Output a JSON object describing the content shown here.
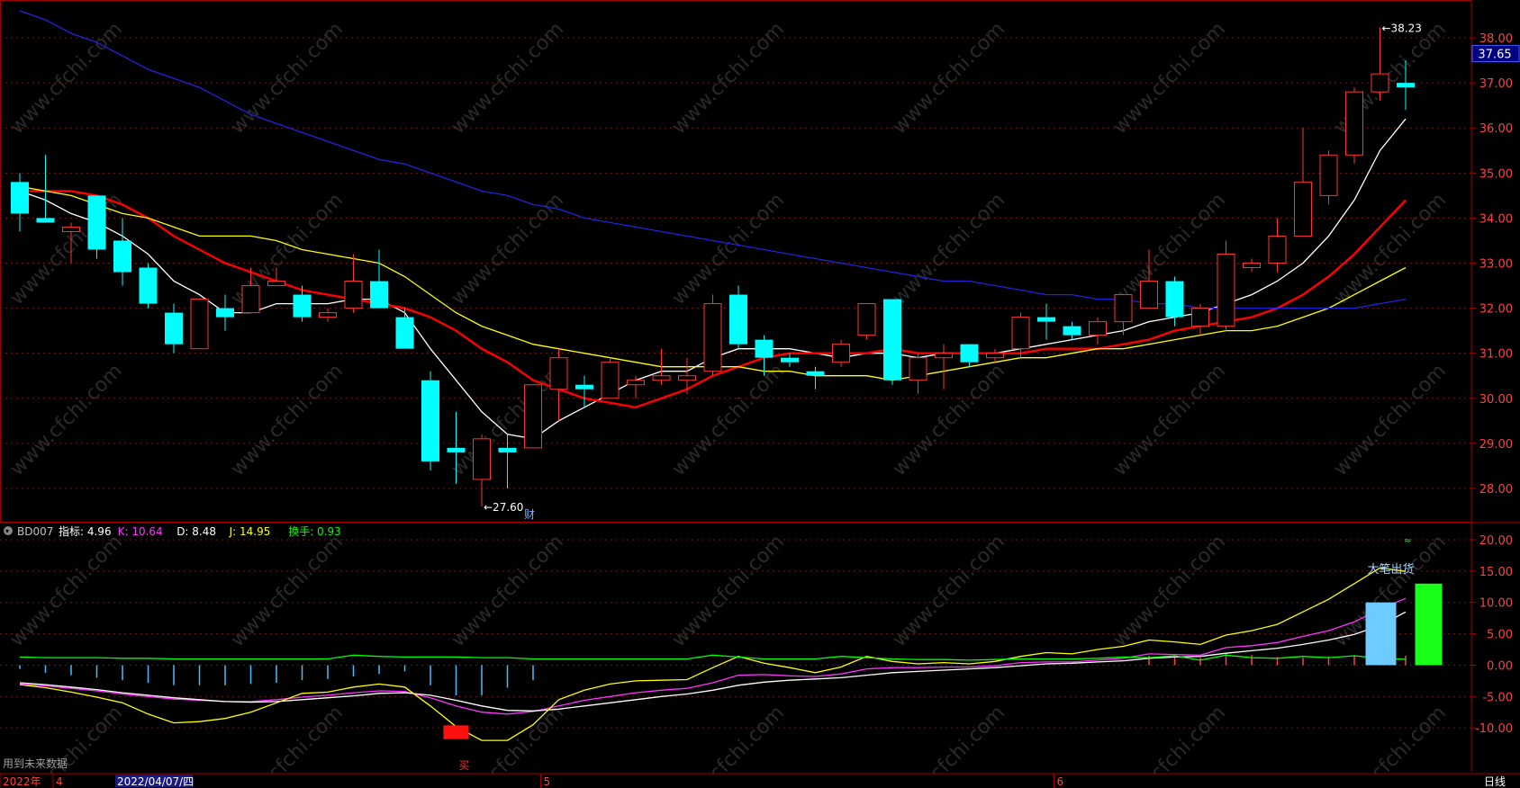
{
  "chart_data": [
    {
      "type": "candlestick",
      "title": "",
      "ylim": [
        27.3,
        38.6
      ],
      "y_ticks": [
        28,
        29,
        30,
        31,
        32,
        33,
        34,
        35,
        36,
        37,
        38
      ],
      "y_tick_labels": [
        "28.00",
        "29.00",
        "30.00",
        "31.00",
        "32.00",
        "33.00",
        "34.00",
        "35.00",
        "36.00",
        "37.00",
        "38.00"
      ],
      "current_price": 37.65,
      "current_price_label": "37.65",
      "max_label": "38.23",
      "min_label": "27.60",
      "event_marker": "财",
      "candles": [
        {
          "o": 34.8,
          "h": 35.0,
          "l": 33.7,
          "c": 34.1
        },
        {
          "o": 34.0,
          "h": 35.4,
          "l": 33.9,
          "c": 33.9
        },
        {
          "o": 33.7,
          "h": 33.9,
          "l": 33.0,
          "c": 33.8
        },
        {
          "o": 34.5,
          "h": 34.5,
          "l": 33.1,
          "c": 33.3
        },
        {
          "o": 33.5,
          "h": 34.0,
          "l": 32.5,
          "c": 32.8
        },
        {
          "o": 32.9,
          "h": 33.0,
          "l": 32.0,
          "c": 32.1
        },
        {
          "o": 31.9,
          "h": 32.1,
          "l": 31.0,
          "c": 31.2
        },
        {
          "o": 31.1,
          "h": 32.2,
          "l": 31.1,
          "c": 32.2
        },
        {
          "o": 32.0,
          "h": 32.3,
          "l": 31.5,
          "c": 31.8
        },
        {
          "o": 31.9,
          "h": 32.9,
          "l": 31.9,
          "c": 32.5
        },
        {
          "o": 32.5,
          "h": 32.9,
          "l": 32.5,
          "c": 32.6
        },
        {
          "o": 32.3,
          "h": 32.5,
          "l": 31.7,
          "c": 31.8
        },
        {
          "o": 31.8,
          "h": 32.0,
          "l": 31.7,
          "c": 31.9
        },
        {
          "o": 32.0,
          "h": 33.2,
          "l": 31.9,
          "c": 32.6
        },
        {
          "o": 32.6,
          "h": 33.3,
          "l": 32.0,
          "c": 32.0
        },
        {
          "o": 31.8,
          "h": 32.0,
          "l": 31.3,
          "c": 31.1
        },
        {
          "o": 30.4,
          "h": 30.6,
          "l": 28.4,
          "c": 28.6
        },
        {
          "o": 28.9,
          "h": 29.7,
          "l": 28.1,
          "c": 28.8
        },
        {
          "o": 28.2,
          "h": 29.2,
          "l": 27.6,
          "c": 29.1
        },
        {
          "o": 28.9,
          "h": 29.2,
          "l": 28.0,
          "c": 28.8
        },
        {
          "o": 28.9,
          "h": 30.3,
          "l": 28.9,
          "c": 30.3
        },
        {
          "o": 30.2,
          "h": 31.1,
          "l": 29.5,
          "c": 30.9
        },
        {
          "o": 30.3,
          "h": 30.5,
          "l": 29.8,
          "c": 30.2
        },
        {
          "o": 30.0,
          "h": 30.9,
          "l": 30.0,
          "c": 30.8
        },
        {
          "o": 30.3,
          "h": 30.5,
          "l": 30.0,
          "c": 30.4
        },
        {
          "o": 30.4,
          "h": 31.1,
          "l": 30.3,
          "c": 30.5
        },
        {
          "o": 30.4,
          "h": 30.9,
          "l": 30.1,
          "c": 30.5
        },
        {
          "o": 30.6,
          "h": 32.3,
          "l": 30.5,
          "c": 32.1
        },
        {
          "o": 32.3,
          "h": 32.5,
          "l": 31.1,
          "c": 31.2
        },
        {
          "o": 31.3,
          "h": 31.4,
          "l": 30.5,
          "c": 30.9
        },
        {
          "o": 30.9,
          "h": 31.0,
          "l": 30.7,
          "c": 30.8
        },
        {
          "o": 30.6,
          "h": 30.7,
          "l": 30.2,
          "c": 30.5
        },
        {
          "o": 30.8,
          "h": 31.3,
          "l": 30.7,
          "c": 31.2
        },
        {
          "o": 31.4,
          "h": 32.1,
          "l": 31.3,
          "c": 32.1
        },
        {
          "o": 32.2,
          "h": 32.2,
          "l": 30.3,
          "c": 30.4
        },
        {
          "o": 30.4,
          "h": 31.0,
          "l": 30.1,
          "c": 30.9
        },
        {
          "o": 30.9,
          "h": 31.2,
          "l": 30.2,
          "c": 31.0
        },
        {
          "o": 31.2,
          "h": 31.2,
          "l": 30.7,
          "c": 30.8
        },
        {
          "o": 30.9,
          "h": 31.1,
          "l": 30.8,
          "c": 31.0
        },
        {
          "o": 31.1,
          "h": 31.9,
          "l": 30.9,
          "c": 31.8
        },
        {
          "o": 31.8,
          "h": 32.1,
          "l": 31.3,
          "c": 31.7
        },
        {
          "o": 31.6,
          "h": 31.7,
          "l": 31.3,
          "c": 31.4
        },
        {
          "o": 31.4,
          "h": 31.8,
          "l": 31.2,
          "c": 31.7
        },
        {
          "o": 31.7,
          "h": 32.3,
          "l": 31.4,
          "c": 32.3
        },
        {
          "o": 32.0,
          "h": 33.3,
          "l": 32.0,
          "c": 32.6
        },
        {
          "o": 32.6,
          "h": 32.7,
          "l": 31.6,
          "c": 31.8
        },
        {
          "o": 31.6,
          "h": 32.1,
          "l": 31.4,
          "c": 32.0
        },
        {
          "o": 31.6,
          "h": 33.5,
          "l": 31.5,
          "c": 33.2
        },
        {
          "o": 32.9,
          "h": 33.1,
          "l": 32.8,
          "c": 33.0
        },
        {
          "o": 33.0,
          "h": 34.0,
          "l": 32.8,
          "c": 33.6
        },
        {
          "o": 33.6,
          "h": 36.0,
          "l": 33.6,
          "c": 34.8
        },
        {
          "o": 34.5,
          "h": 35.5,
          "l": 34.3,
          "c": 35.4
        },
        {
          "o": 35.4,
          "h": 36.9,
          "l": 35.2,
          "c": 36.8
        },
        {
          "o": 36.8,
          "h": 38.23,
          "l": 36.6,
          "c": 37.2
        },
        {
          "o": 37.0,
          "h": 37.5,
          "l": 36.4,
          "c": 36.9
        }
      ],
      "ma": [
        {
          "name": "MA5",
          "color": "#ffffff",
          "values": [
            34.6,
            34.4,
            34.1,
            33.9,
            33.6,
            33.2,
            32.6,
            32.3,
            31.9,
            31.9,
            32.1,
            32.1,
            32.1,
            32.2,
            32.2,
            31.9,
            31.1,
            30.4,
            29.7,
            29.2,
            29.1,
            29.5,
            29.8,
            30.1,
            30.4,
            30.6,
            30.6,
            30.9,
            31.1,
            31.1,
            31.1,
            31.0,
            30.9,
            31.0,
            31.0,
            30.9,
            31.0,
            31.0,
            31.0,
            31.1,
            31.2,
            31.3,
            31.4,
            31.5,
            31.7,
            31.8,
            31.9,
            32.1,
            32.3,
            32.6,
            33.0,
            33.6,
            34.4,
            35.5,
            36.2
          ]
        },
        {
          "name": "MA10",
          "color": "#ff0000",
          "values": [
            34.6,
            34.6,
            34.6,
            34.5,
            34.3,
            34.0,
            33.6,
            33.3,
            33.0,
            32.8,
            32.6,
            32.4,
            32.3,
            32.2,
            32.1,
            32.0,
            31.8,
            31.5,
            31.1,
            30.8,
            30.4,
            30.2,
            30.0,
            29.9,
            29.8,
            30.0,
            30.2,
            30.5,
            30.7,
            30.9,
            31.0,
            31.0,
            31.0,
            31.0,
            31.1,
            31.0,
            31.0,
            31.0,
            31.0,
            31.0,
            31.1,
            31.1,
            31.1,
            31.2,
            31.3,
            31.5,
            31.6,
            31.7,
            31.8,
            32.0,
            32.3,
            32.7,
            33.2,
            33.8,
            34.4
          ]
        },
        {
          "name": "MA20",
          "color": "#ffff00",
          "values": [
            34.7,
            34.6,
            34.5,
            34.3,
            34.1,
            34.0,
            33.8,
            33.6,
            33.6,
            33.6,
            33.5,
            33.3,
            33.2,
            33.1,
            33.0,
            32.7,
            32.3,
            31.9,
            31.6,
            31.4,
            31.2,
            31.1,
            31.0,
            30.9,
            30.8,
            30.7,
            30.7,
            30.7,
            30.7,
            30.6,
            30.6,
            30.5,
            30.5,
            30.5,
            30.4,
            30.5,
            30.6,
            30.7,
            30.8,
            30.9,
            30.9,
            31.0,
            31.1,
            31.1,
            31.2,
            31.3,
            31.4,
            31.5,
            31.5,
            31.6,
            31.8,
            32.0,
            32.3,
            32.6,
            32.9
          ]
        },
        {
          "name": "MA60",
          "color": "#2222dd",
          "values": [
            38.6,
            38.4,
            38.1,
            37.9,
            37.6,
            37.3,
            37.1,
            36.9,
            36.6,
            36.3,
            36.1,
            35.9,
            35.7,
            35.5,
            35.3,
            35.2,
            35.0,
            34.8,
            34.6,
            34.5,
            34.3,
            34.2,
            34.0,
            33.9,
            33.8,
            33.7,
            33.6,
            33.5,
            33.4,
            33.3,
            33.2,
            33.1,
            33.0,
            32.9,
            32.8,
            32.7,
            32.6,
            32.6,
            32.5,
            32.4,
            32.3,
            32.3,
            32.2,
            32.2,
            32.1,
            32.1,
            32.0,
            32.0,
            32.0,
            32.0,
            32.0,
            32.0,
            32.0,
            32.1,
            32.2
          ]
        }
      ]
    },
    {
      "type": "line",
      "title": "BD007",
      "ylim": [
        -17,
        22
      ],
      "y_ticks": [
        20,
        15,
        10,
        5,
        0,
        -5,
        -10
      ],
      "y_tick_labels": [
        "20.00",
        "15.00",
        "10.00",
        "5.00",
        "0.00",
        "-5.00",
        "-10.00"
      ],
      "legend": [
        {
          "label": "BD007",
          "color": "#c0c0c0"
        },
        {
          "label": "指标: 4.96",
          "color": "#ffffff"
        },
        {
          "label": "K: 10.64",
          "color": "#ff33ff"
        },
        {
          "label": "D: 8.48",
          "color": "#ffffff"
        },
        {
          "label": "J: 14.95",
          "color": "#ffff00"
        },
        {
          "label": "换手: 0.93",
          "color": "#00ff00"
        }
      ],
      "series": [
        {
          "name": "K",
          "color": "#ff33ff",
          "values": [
            -3,
            -3.3,
            -3.7,
            -4.1,
            -4.6,
            -5,
            -5.4,
            -5.6,
            -5.8,
            -5.8,
            -5.5,
            -5.1,
            -4.8,
            -4.4,
            -4.1,
            -4.2,
            -5.2,
            -6.5,
            -7.5,
            -7.8,
            -7.4,
            -6.5,
            -5.6,
            -5,
            -4.4,
            -4,
            -3.7,
            -2.8,
            -1.6,
            -1.5,
            -1.7,
            -1.8,
            -1.4,
            -0.6,
            -0.4,
            -0.4,
            -0.3,
            -0.3,
            -0.1,
            0.4,
            0.5,
            0.5,
            0.8,
            1.1,
            1.8,
            1.7,
            1.6,
            2.8,
            3.1,
            3.6,
            4.6,
            5.5,
            6.9,
            8.9,
            10.64
          ]
        },
        {
          "name": "D",
          "color": "#ffffff",
          "values": [
            -2.8,
            -3.1,
            -3.5,
            -3.9,
            -4.4,
            -4.8,
            -5.2,
            -5.5,
            -5.8,
            -5.9,
            -5.8,
            -5.5,
            -5.2,
            -4.9,
            -4.5,
            -4.4,
            -4.8,
            -5.6,
            -6.5,
            -7.2,
            -7.3,
            -7,
            -6.5,
            -6,
            -5.5,
            -5,
            -4.6,
            -4,
            -3.2,
            -2.7,
            -2.4,
            -2.2,
            -2,
            -1.6,
            -1.2,
            -1,
            -0.8,
            -0.6,
            -0.4,
            -0.1,
            0.2,
            0.3,
            0.5,
            0.7,
            1.1,
            1.3,
            1.4,
            1.9,
            2.3,
            2.7,
            3.3,
            4,
            4.9,
            6.3,
            8.48
          ]
        },
        {
          "name": "J",
          "color": "#ffff00",
          "values": [
            -3.1,
            -3.6,
            -4.3,
            -5.1,
            -6,
            -7.8,
            -9.2,
            -9,
            -8.5,
            -7.5,
            -6,
            -4.5,
            -4.3,
            -3.5,
            -3,
            -3.5,
            -6.5,
            -9.8,
            -12,
            -12,
            -9.5,
            -5.5,
            -4,
            -3,
            -2.5,
            -2.4,
            -2.3,
            -0.4,
            1.4,
            0.3,
            -0.4,
            -1.2,
            -0.3,
            1.4,
            0.6,
            0.2,
            0.4,
            0.2,
            0.6,
            1.4,
            2,
            1.8,
            2.5,
            3,
            4,
            3.7,
            3.3,
            4.8,
            5.5,
            6.5,
            8.5,
            10.5,
            13,
            15.5,
            14.95
          ]
        },
        {
          "name": "换手",
          "color": "#00ff00",
          "values": [
            1.3,
            1.2,
            1.2,
            1.2,
            1.1,
            1.1,
            1.0,
            1.0,
            1.0,
            1.0,
            1.0,
            1.0,
            1.0,
            1.6,
            1.4,
            1.3,
            1.3,
            1.3,
            1.2,
            1.2,
            1.0,
            1.0,
            1.0,
            1.0,
            1.0,
            1.0,
            1.0,
            1.6,
            1.3,
            1.0,
            1.0,
            1.0,
            1.4,
            1.2,
            1.0,
            0.9,
            0.9,
            0.8,
            0.9,
            1.0,
            1.0,
            1.0,
            1.1,
            1.3,
            1.2,
            1.5,
            0.8,
            1.6,
            1.2,
            1.1,
            1.4,
            1.2,
            1.5,
            1.1,
            0.93
          ]
        }
      ],
      "histogram_cyan": [
        -0.6,
        -1.2,
        -1.6,
        -2.0,
        -2.4,
        -2.8,
        -3.2,
        -3.2,
        -3.2,
        -3.0,
        -2.8,
        -2.4,
        -2.2,
        -1.8,
        -1.4,
        -1.0,
        -3.2,
        -4.8,
        -4.8,
        -3.6,
        -2.4,
        0,
        0,
        0,
        0,
        0,
        0,
        0,
        0,
        0,
        0,
        0,
        0,
        0,
        0,
        0,
        0,
        0,
        0,
        0,
        0,
        0,
        0,
        0,
        0,
        0,
        0,
        0,
        0,
        0,
        0,
        0,
        0,
        0,
        0
      ],
      "histogram_red": [
        0,
        0,
        0,
        0,
        0,
        0,
        0,
        0,
        0,
        0,
        0,
        0,
        0,
        0,
        0,
        0,
        0,
        0,
        0,
        0,
        0,
        0,
        0,
        0,
        0,
        0,
        0,
        0,
        0,
        0,
        0,
        0,
        0,
        0,
        0,
        0,
        0,
        0,
        0,
        0,
        0,
        0,
        0,
        0,
        1.5,
        1.4,
        1.2,
        1.8,
        1.6,
        1.3,
        1.2,
        1.4,
        1.6,
        1.8,
        1.5
      ],
      "signal_bar_red": {
        "index": 17,
        "from": -9.6,
        "to": -11.8
      },
      "signal_bar_blue": {
        "index": 53,
        "from": 0,
        "to": 10
      },
      "signal_bar_green": {
        "index": 55,
        "from": 0,
        "to": 13
      },
      "signal_label_big": "大笔出货",
      "signal_label_buy": "买",
      "left_note": "用到未来数据"
    }
  ],
  "time_axis": {
    "labels": [
      {
        "text": "2022年",
        "index": 0
      },
      {
        "text": "4",
        "index": 2
      },
      {
        "text": "2022/04/07/四",
        "index": 4
      },
      {
        "text": "5",
        "index": 21
      },
      {
        "text": "6",
        "index": 41
      }
    ],
    "period": "日线"
  },
  "watermark": "www.cfchi.com",
  "colors": {
    "up": "#ff3333",
    "down": "#00ffff",
    "grid": "#7a1010",
    "axis": "#a00000"
  }
}
